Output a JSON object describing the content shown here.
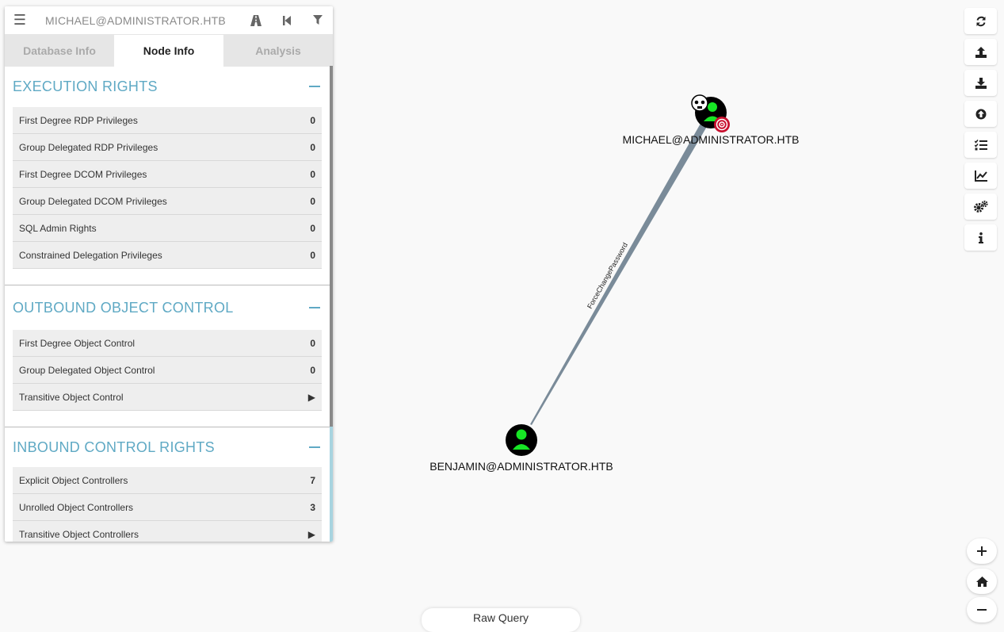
{
  "search": {
    "value": "MICHAEL@ADMINISTRATOR.HTB"
  },
  "icons": {
    "menu": "hamburger-icon",
    "pathfinding": "road-icon",
    "back": "step-backward-icon",
    "filter": "filter-icon"
  },
  "tabs": [
    {
      "label": "Database Info",
      "active": false
    },
    {
      "label": "Node Info",
      "active": true
    },
    {
      "label": "Analysis",
      "active": false
    }
  ],
  "sections": [
    {
      "title": "EXECUTION RIGHTS",
      "rows": [
        {
          "label": "First Degree RDP Privileges",
          "value": "0"
        },
        {
          "label": "Group Delegated RDP Privileges",
          "value": "0"
        },
        {
          "label": "First Degree DCOM Privileges",
          "value": "0"
        },
        {
          "label": "Group Delegated DCOM Privileges",
          "value": "0"
        },
        {
          "label": "SQL Admin Rights",
          "value": "0"
        },
        {
          "label": "Constrained Delegation Privileges",
          "value": "0"
        }
      ]
    },
    {
      "title": "OUTBOUND OBJECT CONTROL",
      "rows": [
        {
          "label": "First Degree Object Control",
          "value": "0"
        },
        {
          "label": "Group Delegated Object Control",
          "value": "0"
        },
        {
          "label": "Transitive Object Control",
          "value": "▶"
        }
      ]
    },
    {
      "title": "INBOUND CONTROL RIGHTS",
      "rows": [
        {
          "label": "Explicit Object Controllers",
          "value": "7"
        },
        {
          "label": "Unrolled Object Controllers",
          "value": "3"
        },
        {
          "label": "Transitive Object Controllers",
          "value": "▶"
        }
      ]
    }
  ],
  "graph": {
    "nodes": [
      {
        "label": "MICHAEL@ADMINISTRATOR.HTB",
        "owned": true,
        "target": true
      },
      {
        "label": "BENJAMIN@ADMINISTRATOR.HTB",
        "owned": false,
        "target": false
      }
    ],
    "edge": {
      "label": "ForceChangePassword"
    },
    "colors": {
      "user_fill": "#17e625",
      "node_bg": "#000000",
      "edge": "#7a8b99",
      "section_title": "#5fa9c4",
      "target": "#c8102e"
    }
  },
  "toolbar": {
    "buttons": [
      "refresh-icon",
      "upload-icon",
      "download-icon",
      "upload-circle-icon",
      "tasks-icon",
      "chart-line-icon",
      "cogs-icon",
      "info-icon"
    ]
  },
  "zoom": {
    "buttons": [
      "plus-icon",
      "home-icon",
      "minus-icon"
    ]
  },
  "raw_query": {
    "label": "Raw Query"
  }
}
